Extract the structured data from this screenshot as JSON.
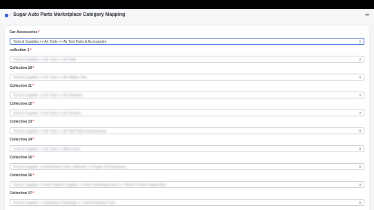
{
  "header": {
    "title": "Sugar Auto Parts Marketplace Category Mapping",
    "separator": "›",
    "more": "•••"
  },
  "fields": [
    {
      "label": "Car Accessories",
      "required": true,
      "value": "Tools & Supplies >> Air Tools >> Air Tool Parts & Accessories",
      "blurred": false
    },
    {
      "label": "collection 1",
      "required": true,
      "value": "Tools & Supplies >> Air Tools >> Air Drills",
      "blurred": true
    },
    {
      "label": "Collection 10",
      "required": true,
      "value": "Tools & Supplies >> Air Tools >> Air Nibbler Sets",
      "blurred": true
    },
    {
      "label": "Collection 11",
      "required": true,
      "value": "Tools & Supplies >> Air Tools >> Air Ratchets",
      "blurred": true
    },
    {
      "label": "Collection 12",
      "required": true,
      "value": "Tools & Supplies >> Air Tools >> Air Sanders",
      "blurred": true
    },
    {
      "label": "Collection 13",
      "required": true,
      "value": "Tools & Supplies >> Air Tools >> Air Tool Parts & Accessories",
      "blurred": true
    },
    {
      "label": "Collection 14",
      "required": true,
      "value": "Tools & Supplies >> Air Tools >> Blow Guns",
      "blurred": true
    },
    {
      "label": "Collection 15",
      "required": true,
      "value": "Tools & Supplies >> Automotive Tools Cabinetry >> Engine Oil Dispensers",
      "blurred": true
    },
    {
      "label": "Collection 16",
      "required": true,
      "value": "Tools & Supplies >> Auto Detail & Supplies >> Auto Detail Applicators >> Wheel Cleaner Applicators",
      "blurred": true
    },
    {
      "label": "Collection 17",
      "required": true,
      "value": "Tools & Supplies >> Bushings & Bearings >> Vehicle Bearing Tools",
      "blurred": true
    }
  ]
}
